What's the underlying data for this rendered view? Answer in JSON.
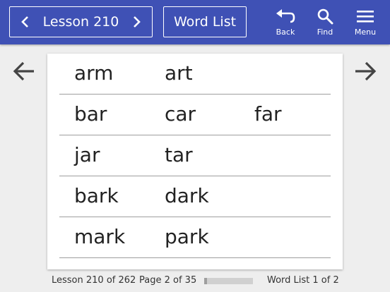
{
  "header": {
    "lesson_label": "Lesson 210",
    "word_list_button": "Word List",
    "tools": [
      {
        "label": "Back",
        "icon": "undo-icon"
      },
      {
        "label": "Find",
        "icon": "search-icon"
      },
      {
        "label": "Menu",
        "icon": "hamburger-icon"
      }
    ]
  },
  "word_rows": [
    [
      "arm",
      "art",
      ""
    ],
    [
      "bar",
      "car",
      "far"
    ],
    [
      "jar",
      "tar",
      ""
    ],
    [
      "bark",
      "dark",
      ""
    ],
    [
      "mark",
      "park",
      ""
    ]
  ],
  "footer": {
    "lesson_progress": "Lesson 210 of 262",
    "page": "Page 2 of 35",
    "progress_fraction": 0.057,
    "word_list": "Word List 1 of 2"
  },
  "colors": {
    "header_bg": "#3f51b5",
    "page_bg": "#eeeeee"
  }
}
